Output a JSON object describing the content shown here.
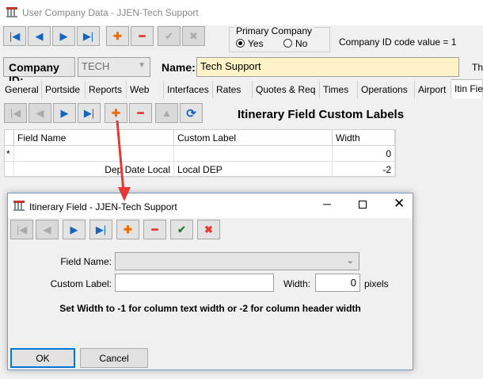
{
  "window": {
    "title": "User Company Data - JJEN-Tech Support"
  },
  "toolbar_main": {
    "buttons": [
      {
        "icon": "first-record-icon",
        "glyph": "|◀"
      },
      {
        "icon": "prev-record-icon",
        "glyph": "◀"
      },
      {
        "icon": "next-record-icon",
        "glyph": "▶"
      },
      {
        "icon": "last-record-icon",
        "glyph": "▶|"
      },
      {
        "icon": "add-icon",
        "glyph": "✚"
      },
      {
        "icon": "delete-icon",
        "glyph": "━"
      },
      {
        "icon": "confirm-icon",
        "glyph": "✔"
      },
      {
        "icon": "cancel-icon",
        "glyph": "✖"
      }
    ]
  },
  "primary_company": {
    "legend": "Primary Company",
    "yes_label": "Yes",
    "no_label": "No",
    "selected": "Yes"
  },
  "company_id_code": "Company ID code value = 1",
  "company_id": {
    "label": "Company ID:",
    "value": "TECH"
  },
  "name": {
    "label": "Name:",
    "value": "Tech Support",
    "overflow_label": "Th"
  },
  "tabs": [
    "General",
    "Portside",
    "Reports",
    "Web",
    "Interfaces",
    "Rates",
    "Quotes & Req",
    "Times",
    "Operations",
    "Airport",
    "Itin Fie"
  ],
  "active_tab": "Itin Fie",
  "panel": {
    "title": "Itinerary Field Custom Labels",
    "grid": {
      "headers": [
        "Field Name",
        "Custom Label",
        "Width"
      ],
      "rows": [
        {
          "marker": "*",
          "field_name": "",
          "custom_label": "",
          "width": "0"
        },
        {
          "marker": "",
          "field_name": "Dep Date Local",
          "custom_label": "Local DEP",
          "width": "-2"
        }
      ]
    }
  },
  "dialog": {
    "title": "Itinerary Field - JJEN-Tech Support",
    "field_name_label": "Field Name:",
    "field_name_value": "",
    "custom_label_label": "Custom Label:",
    "custom_label_value": "",
    "width_label": "Width:",
    "width_value": "0",
    "width_unit": "pixels",
    "hint": "Set Width to -1 for column text width or -2 for column header width",
    "ok_label": "OK",
    "cancel_label": "Cancel"
  },
  "colors": {
    "name_field_bg": "#fdf3c7",
    "arrow": "#e53935",
    "accent_blue": "#1565c0"
  }
}
